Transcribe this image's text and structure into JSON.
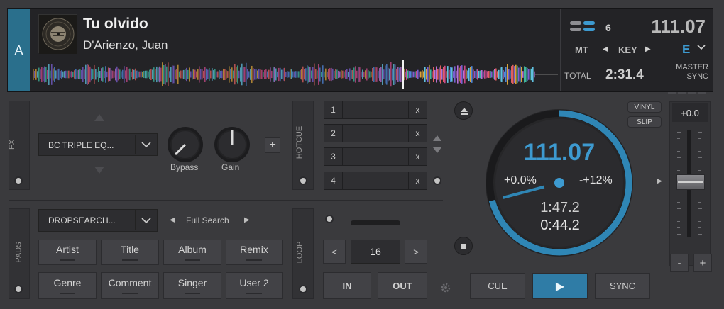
{
  "deck": {
    "letter": "A",
    "title": "Tu olvido",
    "artist": "D'Arienzo, Juan",
    "layer_count": "6",
    "bpm": "111.07",
    "mt_label": "MT",
    "key_label": "KEY",
    "key_value": "E",
    "total_label": "TOTAL",
    "total_time": "2:31.4",
    "master_label": "MASTER",
    "sync_label": "SYNC"
  },
  "fx": {
    "tab_label": "FX",
    "effect": "BC TRIPLE EQ...",
    "knobs": [
      {
        "label": "Bypass"
      },
      {
        "label": "Gain"
      }
    ],
    "add_label": "+"
  },
  "hotcue": {
    "tab_label": "HOTCUE",
    "rows": [
      {
        "num": "1",
        "clear": "x"
      },
      {
        "num": "2",
        "clear": "x"
      },
      {
        "num": "3",
        "clear": "x"
      },
      {
        "num": "4",
        "clear": "x"
      }
    ]
  },
  "pads": {
    "tab_label": "PADS",
    "mode": "DROPSEARCH...",
    "search_mode": "Full Search",
    "buttons": [
      "Artist",
      "Title",
      "Album",
      "Remix",
      "Genre",
      "Comment",
      "Singer",
      "User 2"
    ]
  },
  "loop": {
    "tab_label": "LOOP",
    "prev": "<",
    "size": "16",
    "next": ">",
    "in_label": "IN",
    "out_label": "OUT"
  },
  "platter": {
    "bpm": "111.07",
    "pitch_pct": "+0.0%",
    "pitch_range": "-+12%",
    "elapsed": "1:47.2",
    "remain": "0:44.2",
    "progress": 0.709
  },
  "transport": {
    "vinyl_label": "VINYL",
    "slip_label": "SLIP",
    "cue_label": "CUE",
    "play_label": "▶",
    "sync_label": "SYNC"
  },
  "pitch": {
    "readout": "+0.0",
    "minus_label": "-",
    "plus_label": "+"
  },
  "colors": {
    "accent": "#3d9ad0",
    "deck_tab": "#2a6f8c",
    "play_button": "#2f7ca6"
  }
}
